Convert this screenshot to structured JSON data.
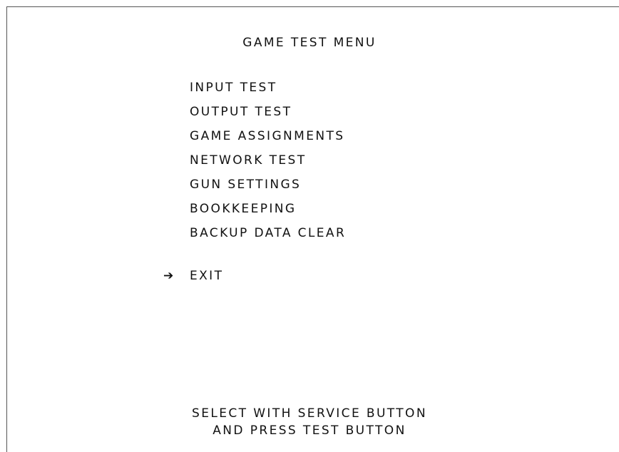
{
  "title": "GAME TEST MENU",
  "menu_items": [
    {
      "label": "INPUT TEST"
    },
    {
      "label": "OUTPUT TEST"
    },
    {
      "label": "GAME ASSIGNMENTS"
    },
    {
      "label": "NETWORK TEST"
    },
    {
      "label": "GUN SETTINGS"
    },
    {
      "label": "BOOKKEEPING"
    },
    {
      "label": "BACKUP DATA CLEAR"
    }
  ],
  "exit": {
    "cursor": "➔",
    "label": "EXIT"
  },
  "instructions": {
    "line1": "SELECT WITH SERVICE BUTTON",
    "line2": "AND PRESS TEST BUTTON"
  }
}
